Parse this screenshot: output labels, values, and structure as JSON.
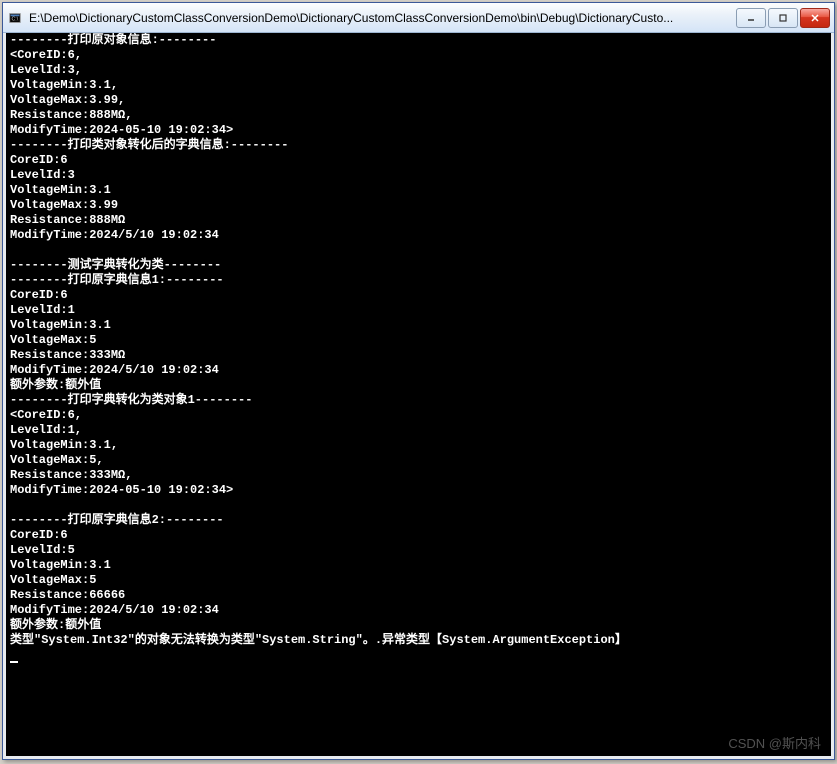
{
  "window": {
    "title": "E:\\Demo\\DictionaryCustomClassConversionDemo\\DictionaryCustomClassConversionDemo\\bin\\Debug\\DictionaryCusto..."
  },
  "watermark": "CSDN @斯内科",
  "console": {
    "lines": [
      "--------打印原对象信息:--------",
      "<CoreID:6,",
      "LevelId:3,",
      "VoltageMin:3.1,",
      "VoltageMax:3.99,",
      "Resistance:888MΩ,",
      "ModifyTime:2024-05-10 19:02:34>",
      "--------打印类对象转化后的字典信息:--------",
      "CoreID:6",
      "LevelId:3",
      "VoltageMin:3.1",
      "VoltageMax:3.99",
      "Resistance:888MΩ",
      "ModifyTime:2024/5/10 19:02:34",
      "",
      "--------测试字典转化为类--------",
      "--------打印原字典信息1:--------",
      "CoreID:6",
      "LevelId:1",
      "VoltageMin:3.1",
      "VoltageMax:5",
      "Resistance:333MΩ",
      "ModifyTime:2024/5/10 19:02:34",
      "额外参数:额外值",
      "--------打印字典转化为类对象1--------",
      "<CoreID:6,",
      "LevelId:1,",
      "VoltageMin:3.1,",
      "VoltageMax:5,",
      "Resistance:333MΩ,",
      "ModifyTime:2024-05-10 19:02:34>",
      "",
      "--------打印原字典信息2:--------",
      "CoreID:6",
      "LevelId:5",
      "VoltageMin:3.1",
      "VoltageMax:5",
      "Resistance:66666",
      "ModifyTime:2024/5/10 19:02:34",
      "额外参数:额外值",
      "类型\"System.Int32\"的对象无法转换为类型\"System.String\"。.异常类型【System.ArgumentException】"
    ]
  }
}
